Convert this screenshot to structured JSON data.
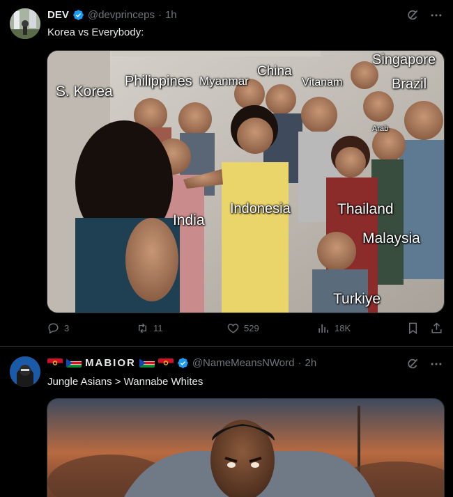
{
  "tweets": [
    {
      "name": "DEV",
      "handle": "@devprinceps",
      "separator": "·",
      "time": "1h",
      "text": "Korea vs Everybody:",
      "media_labels": [
        "S. Korea",
        "Philippines",
        "Myanmar",
        "China",
        "Vitanam",
        "Singapore",
        "Brazil",
        "Arab",
        "India",
        "Indonesia",
        "Thailand",
        "Malaysia",
        "Turkiye"
      ],
      "stats": {
        "replies": "3",
        "reposts": "11",
        "likes": "529",
        "views": "18K"
      }
    },
    {
      "name": "MABIOR",
      "handle": "@NameMeansNWord",
      "separator": "·",
      "time": "2h",
      "text": "Jungle Asians > Wannabe Whites"
    }
  ],
  "icons": {
    "verified": "verified-badge-icon",
    "grok": "grok-icon",
    "more": "more-icon",
    "reply": "reply-icon",
    "repost": "repost-icon",
    "like": "like-icon",
    "views": "views-icon",
    "bookmark": "bookmark-icon",
    "share": "share-icon"
  },
  "colors": {
    "background": "#000000",
    "text": "#e7e9ea",
    "muted": "#71767b",
    "verified": "#1d9bf0",
    "divider": "#2f3336"
  }
}
